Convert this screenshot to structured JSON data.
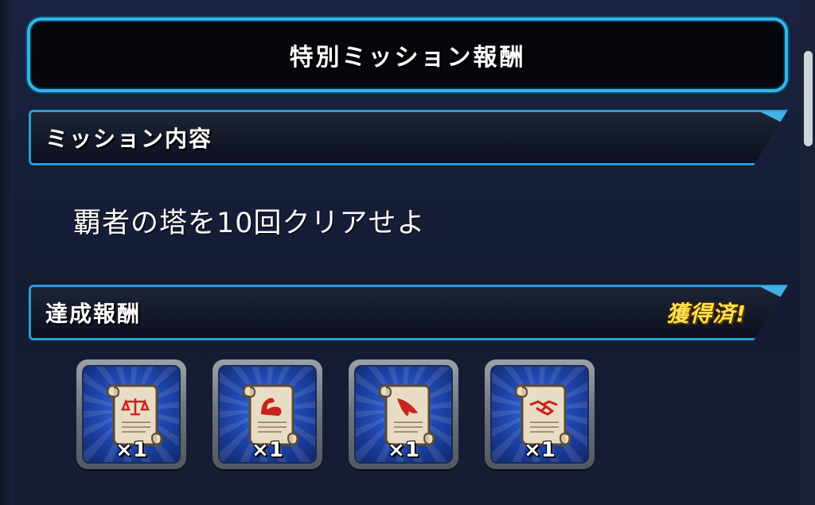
{
  "title": "特別ミッション報酬",
  "mission_section": {
    "label": "ミッション内容",
    "description": "覇者の塔を10回クリアせよ"
  },
  "reward_section": {
    "label": "達成報酬",
    "status": "獲得済!"
  },
  "rewards": [
    {
      "icon": "scroll-scales-icon",
      "quantity": "×1"
    },
    {
      "icon": "scroll-flexed-arm-icon",
      "quantity": "×1"
    },
    {
      "icon": "scroll-wing-icon",
      "quantity": "×1"
    },
    {
      "icon": "scroll-handshake-icon",
      "quantity": "×1"
    }
  ],
  "colors": {
    "frame_accent": "#34b4e6",
    "status_yellow": "#ffe24a",
    "background": "#161d33",
    "emblem_red": "#c8241c"
  }
}
